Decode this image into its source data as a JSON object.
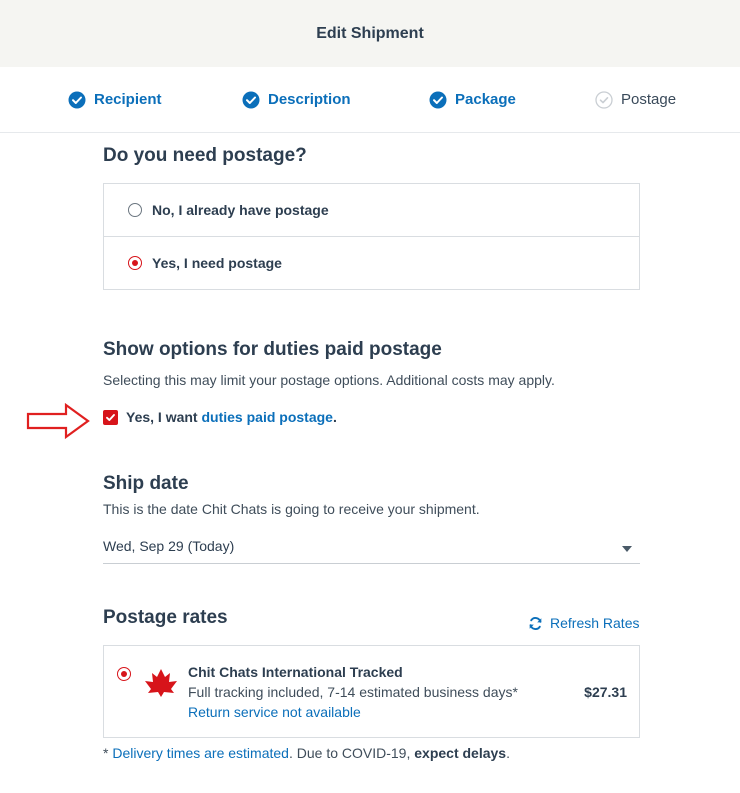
{
  "header": {
    "title": "Edit Shipment"
  },
  "steps": [
    {
      "label": "Recipient",
      "state": "complete"
    },
    {
      "label": "Description",
      "state": "complete"
    },
    {
      "label": "Package",
      "state": "complete"
    },
    {
      "label": "Postage",
      "state": "pending"
    }
  ],
  "postage_need": {
    "title": "Do you need postage?",
    "options": [
      {
        "label": "No, I already have postage",
        "selected": false
      },
      {
        "label": "Yes, I need postage",
        "selected": true
      }
    ]
  },
  "duties": {
    "title": "Show options for duties paid postage",
    "description": "Selecting this may limit your postage options. Additional costs may apply.",
    "checkbox_prefix": "Yes, I want ",
    "checkbox_link": "duties paid postage",
    "checkbox_suffix": ".",
    "checked": true
  },
  "ship_date": {
    "title": "Ship date",
    "description": "This is the date Chit Chats is going to receive your shipment.",
    "selected_value": "Wed, Sep 29 (Today)"
  },
  "rates": {
    "title": "Postage rates",
    "refresh_label": "Refresh Rates",
    "items": [
      {
        "name": "Chit Chats International Tracked",
        "description": "Full tracking included, 7-14 estimated business days*",
        "return_note": "Return service not available",
        "price": "$27.31",
        "selected": true
      }
    ]
  },
  "footnote": {
    "prefix": "* ",
    "link": "Delivery times are estimated",
    "middle": ". Due to COVID-19, ",
    "bold": "expect delays",
    "suffix": "."
  },
  "colors": {
    "accent_blue": "#0b6fba",
    "brand_red": "#d7141a",
    "annotation_arrow": "#e02020"
  },
  "icons": [
    "check-circle-icon",
    "refresh-icon",
    "maple-leaf-icon",
    "checkmark-icon",
    "arrow-right-icon",
    "chevron-down-icon"
  ]
}
